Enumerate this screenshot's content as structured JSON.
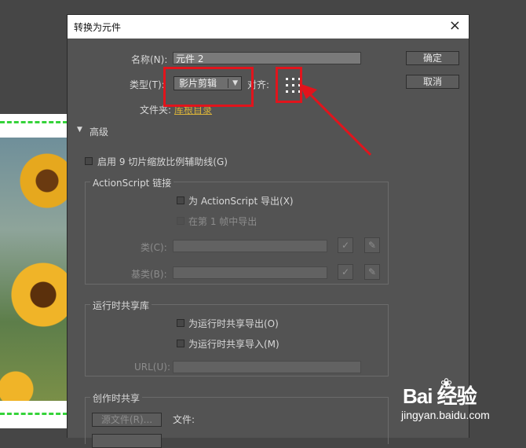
{
  "dialog": {
    "title": "转换为元件",
    "close_icon": "×"
  },
  "fields": {
    "name_label": "名称(N):",
    "name_value": "元件 2",
    "type_label": "类型(T):",
    "type_value": "影片剪辑",
    "align_label": "对齐:",
    "folder_label": "文件夹:",
    "folder_value": "库根目录"
  },
  "buttons": {
    "ok": "确定",
    "cancel": "取消"
  },
  "advanced": {
    "toggle_label": "高级",
    "enable_9slice": "启用 9 切片缩放比例辅助线(G)"
  },
  "actionscript": {
    "legend": "ActionScript 链接",
    "export_for_as": "为 ActionScript 导出(X)",
    "export_frame1": "在第 1 帧中导出",
    "class_label": "类(C):",
    "base_class_label": "基类(B):"
  },
  "runtime_sharing": {
    "legend": "运行时共享库",
    "export_runtime": "为运行时共享导出(O)",
    "import_runtime": "为运行时共享导入(M)",
    "url_label": "URL(U):"
  },
  "authoring_sharing": {
    "legend": "创作时共享",
    "source_button": "源文件(R)...",
    "file_label": "文件:"
  },
  "watermark": {
    "brand": "Bai 经验",
    "sub": "jingyan.baidu.com"
  },
  "colors": {
    "highlight": "#e1141c",
    "folder_link": "#d9b23a",
    "guide": "#35d33a"
  }
}
